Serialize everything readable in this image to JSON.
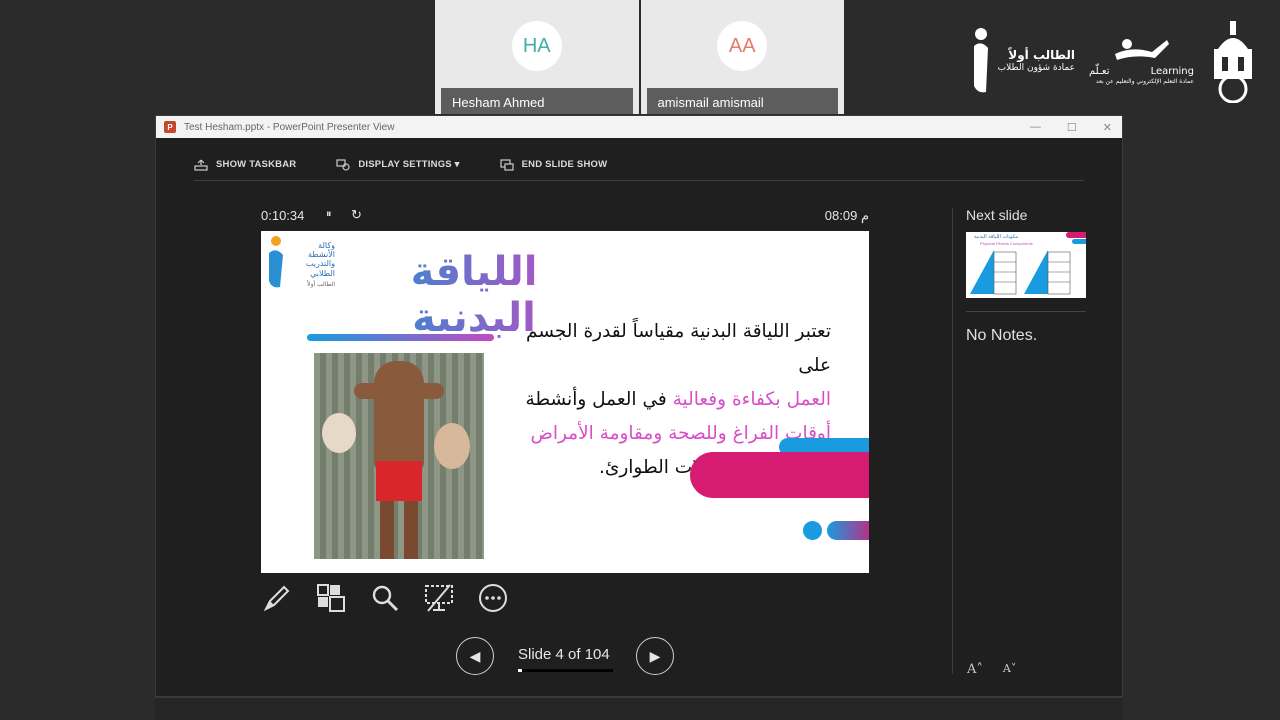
{
  "participants": [
    {
      "initials": "HA",
      "name": "Hesham Ahmed",
      "initials_color": "#3fb1a5"
    },
    {
      "initials": "AA",
      "name": "amismail amismail",
      "initials_color": "#e57c6b"
    }
  ],
  "logos": {
    "student_first_text": "الطالب أولاً",
    "student_affairs_text": "عمادة شؤون الطلاب",
    "learning_en": "Learning",
    "learning_ar": "تعـلّم",
    "elearning_deanship": "عمادة التعلم الإلكتروني والتعليم عن بعد"
  },
  "window": {
    "title": "Test Hesham.pptx - PowerPoint Presenter View",
    "controls": [
      "—",
      "☐",
      "✕"
    ]
  },
  "toolbar": {
    "show_taskbar": "SHOW TASKBAR",
    "display_settings": "DISPLAY SETTINGS ▾",
    "end_slide_show": "END SLIDE SHOW"
  },
  "presenter": {
    "elapsed": "0:10:34",
    "pause_glyph": "⏸",
    "reset_glyph": "↻",
    "clock": "08:09 م"
  },
  "slide": {
    "org_logo_text": "وكالة الأنشطة والتدريب الطلابي",
    "org_logo_sub": "الطالب أولاً",
    "title": "اللياقة البدنية",
    "line1": "تعتبر اللياقة البدنية مقياساً لقدرة الجسم على",
    "line2_highlight": "العمل بكفاءة وفعالية",
    "line2_rest": " في العمل وأنشطة",
    "line3": "أوقات الفراغ  وللصحة ومقاومة الأمراض",
    "line4": "وتلبية حالات الطوارئ."
  },
  "next_slide": {
    "label": "Next slide",
    "thumb_title": "مكونات اللياقة البدنية",
    "thumb_sub": "Physical Fitness Components"
  },
  "notes": "No Notes.",
  "font_controls": [
    "A˄",
    "A˅"
  ],
  "navigation": {
    "slide_counter": "Slide 4 of 104",
    "progress": 0.038
  },
  "colors": {
    "accent_pink": "#d61b72",
    "accent_blue": "#1a9be0",
    "title_gradient_start": "#2a8fd4",
    "title_gradient_end": "#c44ac0"
  }
}
